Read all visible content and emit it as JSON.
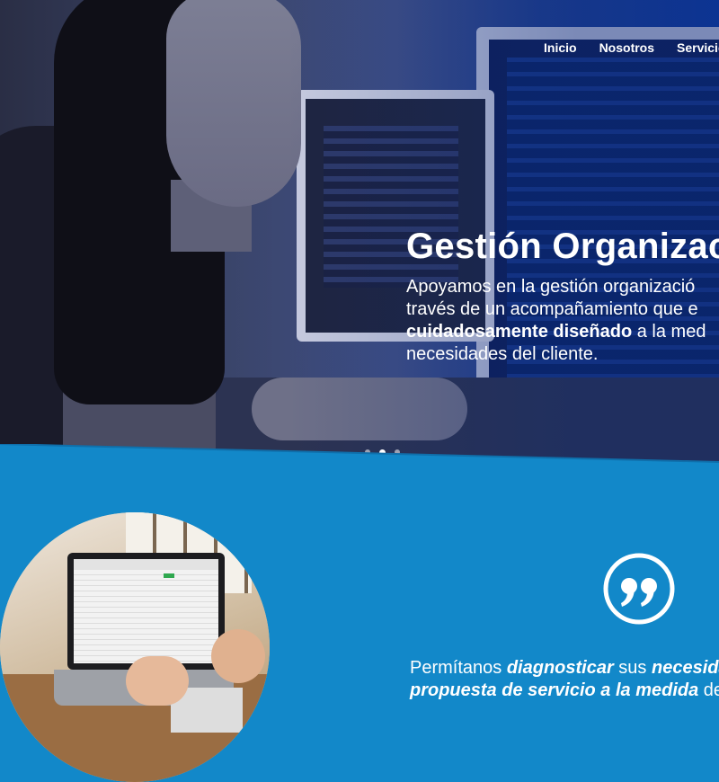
{
  "nav": {
    "items": [
      {
        "label": "Inicio"
      },
      {
        "label": "Nosotros"
      },
      {
        "label": "Servicio"
      }
    ]
  },
  "hero": {
    "title": "Gestión Organizacio",
    "line1": "Apoyamos en la gestión organizació",
    "line2": "través de un acompañamiento que e",
    "line3_bold": "cuidadosamente diseñado",
    "line3_rest": " a la med",
    "line4": "necesidades del cliente."
  },
  "carousel": {
    "slides": 3,
    "active_index": 1
  },
  "quote": {
    "icon": "quote-icon"
  },
  "cta": {
    "part1": "Permítanos ",
    "part2_bold": "diagnosticar",
    "part3": " sus ",
    "part4_bold": "necesidad",
    "line2_bold": "propuesta de servicio a la medida",
    "line2_rest": " de su"
  },
  "colors": {
    "accent_blue": "#1288c9",
    "hero_overlay": "#0d3aa0",
    "text": "#ffffff"
  }
}
